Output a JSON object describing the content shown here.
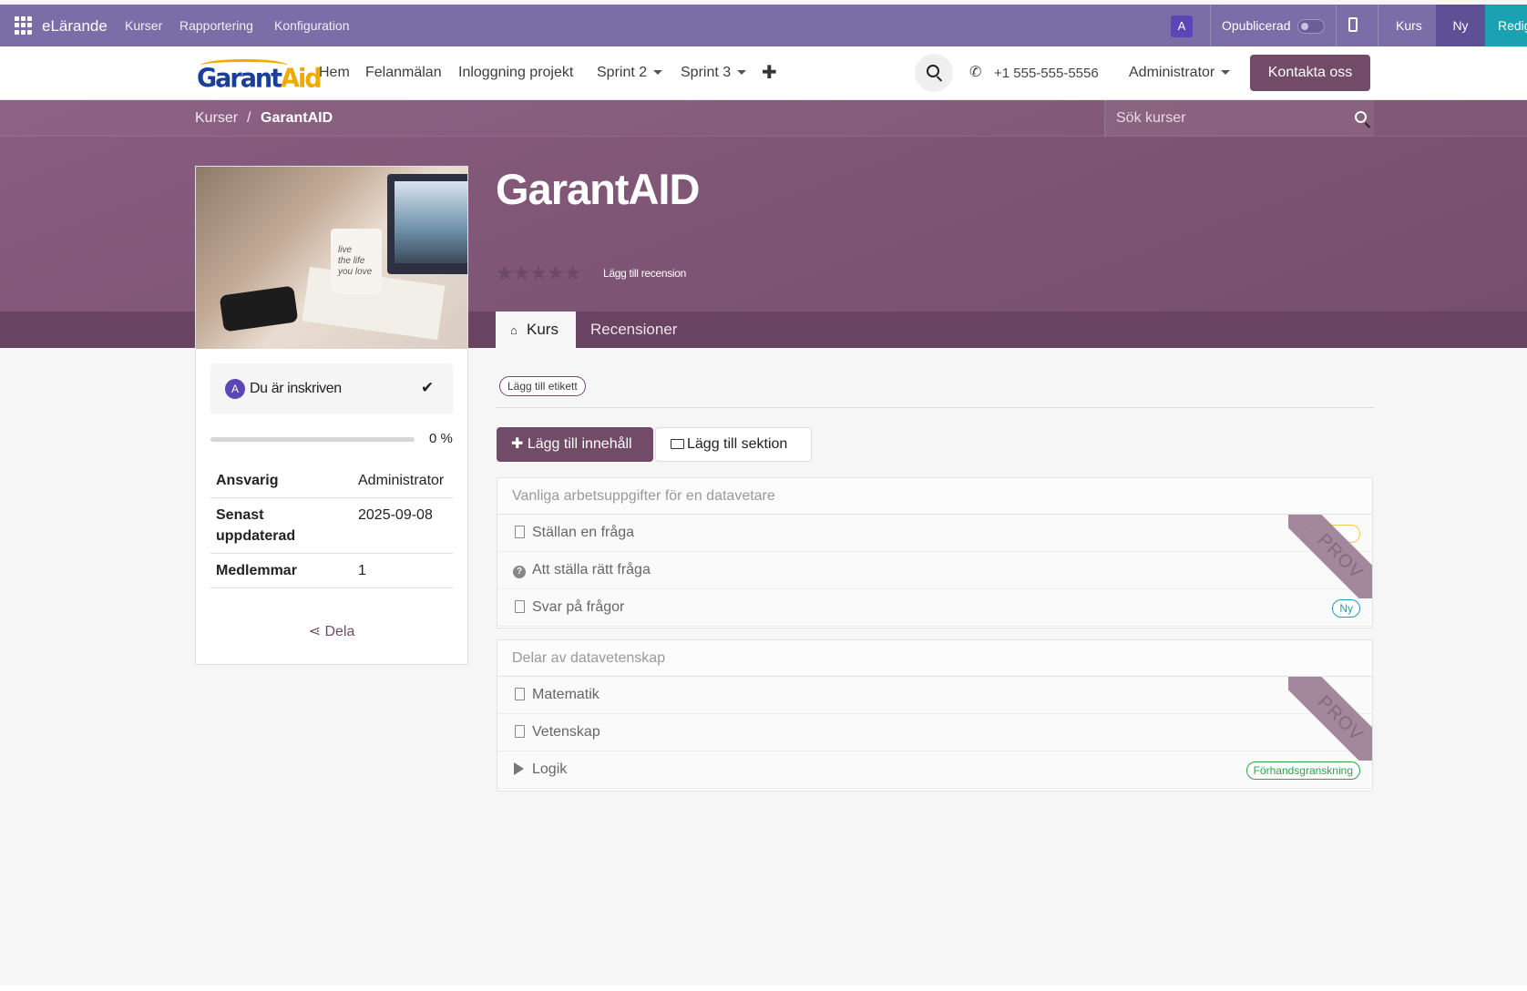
{
  "adminbar": {
    "app_name": "eLärande",
    "menu": [
      "Kurser",
      "Rapportering",
      "Konfiguration"
    ],
    "avatar_letter": "A",
    "publish_status": "Opublicerad",
    "course_btn": "Kurs",
    "new_btn": "Ny",
    "edit_btn": "Redigera",
    "accent_color": "#7a6da8"
  },
  "header": {
    "logo_text_a": "Garant",
    "logo_text_b": "Aid",
    "nav": {
      "home": "Hem",
      "report": "Felanmälan",
      "login_project": "Inloggning projekt",
      "sprint2": "Sprint 2",
      "sprint3": "Sprint 3"
    },
    "phone": "+1 555-555-5556",
    "user_menu": "Administrator",
    "contact_btn": "Kontakta oss"
  },
  "breadcrumb": {
    "parent": "Kurser",
    "separator": "/",
    "current": "GarantAID"
  },
  "search": {
    "placeholder": "Sök kurser"
  },
  "course": {
    "title": "GarantAID",
    "stars": "★★★★★",
    "rating_value": 0,
    "add_review": "Lägg till recension",
    "tabs": {
      "course": "Kurs",
      "reviews": "Recensioner"
    },
    "brand_color": "#714b67"
  },
  "sidebar": {
    "avatar_letter": "A",
    "enrolled_text": "Du är inskriven",
    "progress_fraction": 0,
    "progress_text": "0 %",
    "info": {
      "responsible_label": "Ansvarig",
      "responsible_value": "Administrator",
      "updated_label": "Senast uppdaterad",
      "updated_value": "2025-09-08",
      "members_label": "Medlemmar",
      "members_value": "1"
    },
    "share": "Dela"
  },
  "content": {
    "add_tag": "Lägg till etikett",
    "add_content": "Lägg till innehåll",
    "add_section": "Lägg till sektion",
    "sections": [
      {
        "title": "Vanliga arbetsuppgifter för en datavetare",
        "ribbon": "PROV",
        "items": [
          {
            "icon": "document-icon",
            "label": "Ställan en fråga"
          },
          {
            "icon": "question-circle-icon",
            "label": "Att ställa rätt fråga"
          },
          {
            "icon": "pdf-icon",
            "label": "Svar på frågor",
            "badge": "Ny"
          }
        ]
      },
      {
        "title": "Delar av datavetenskap",
        "ribbon": "PROV",
        "items": [
          {
            "icon": "pdf-icon",
            "label": "Matematik"
          },
          {
            "icon": "pdf-icon",
            "label": "Vetenskap"
          },
          {
            "icon": "play-icon",
            "label": "Logik",
            "badge": "Förhandsgranskning"
          }
        ]
      }
    ]
  }
}
